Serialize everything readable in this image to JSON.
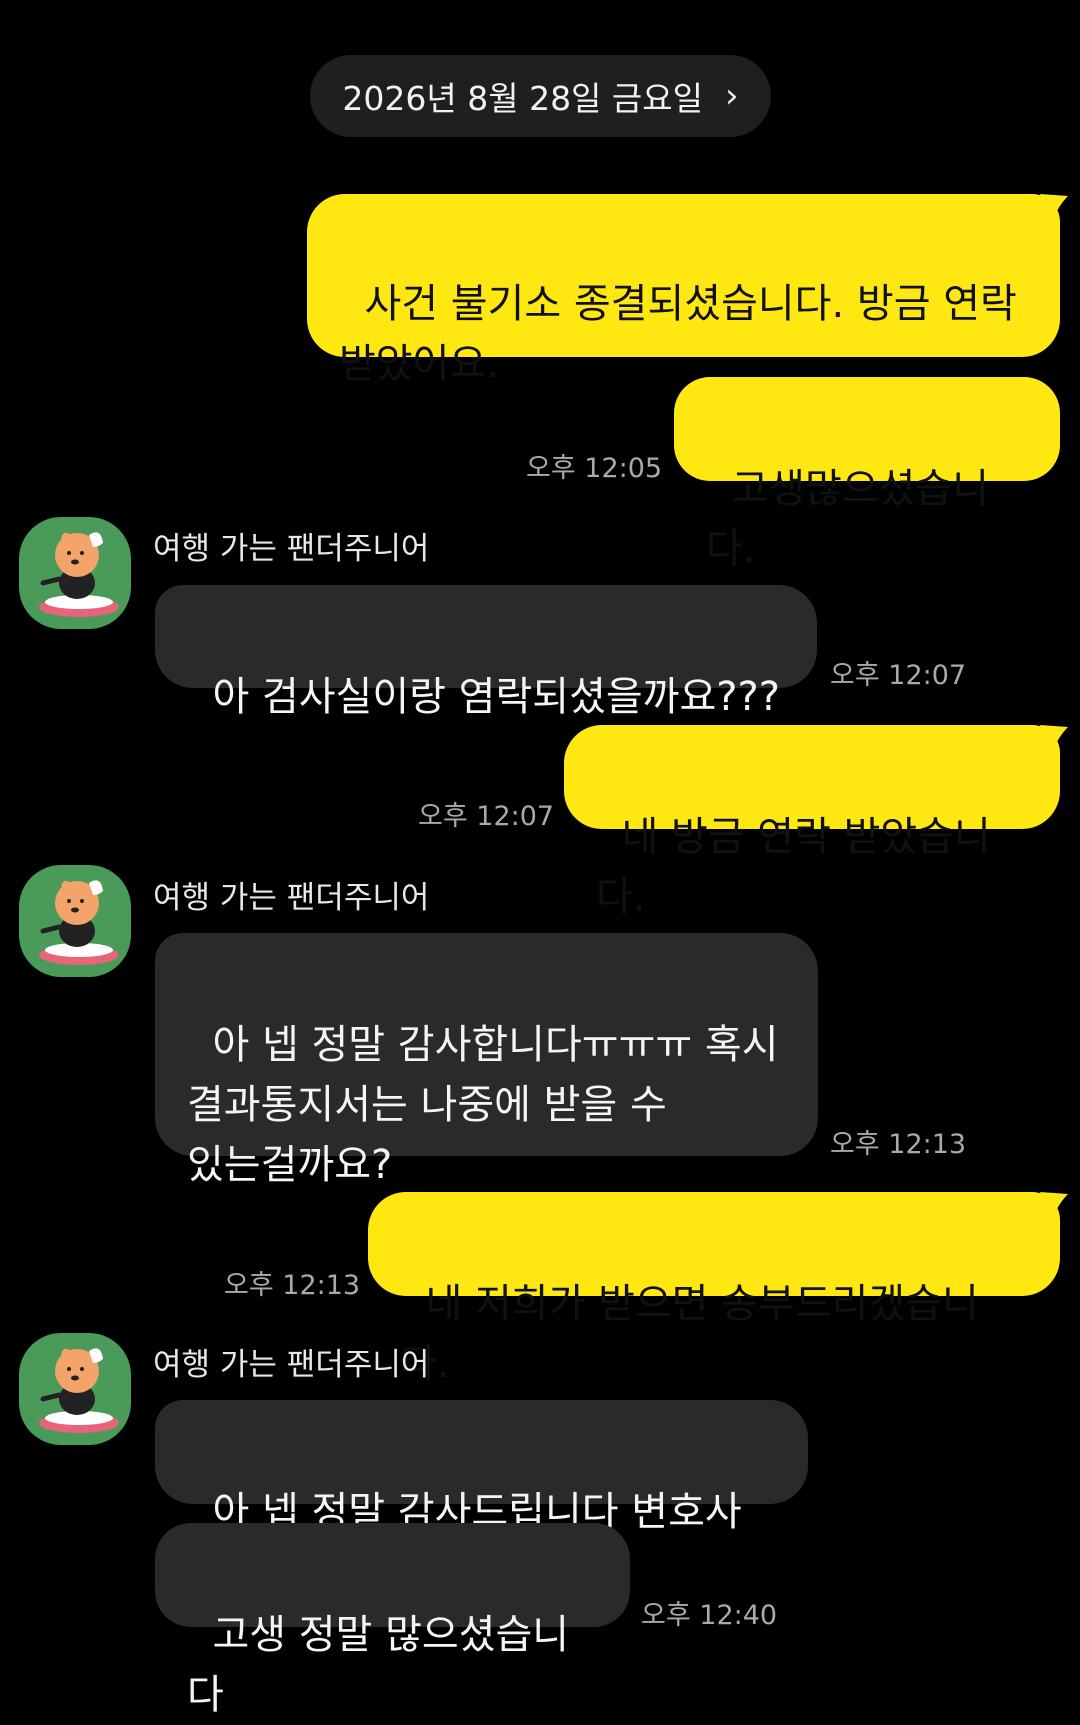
{
  "date_divider": {
    "label": "2026년 8월 28일 금요일",
    "chevron": "›"
  },
  "messages": [
    {
      "side": "sent",
      "text": "사건 불기소 종결되셨습니다. 방금 연락\n받았어요.",
      "time": ""
    },
    {
      "side": "sent",
      "text": "고생많으셨습니다.",
      "time": "오후 12:05"
    },
    {
      "side": "recv",
      "sender": "여행 가는 팬더주니어",
      "text": "아 검사실이랑 염락되셨을까요???",
      "time": "오후 12:07"
    },
    {
      "side": "sent",
      "text": "네 방금 연락 받았습니다.",
      "time": "오후 12:07"
    },
    {
      "side": "recv",
      "sender": "여행 가는 팬더주니어",
      "text": "아 넵 정말 감사합니다ㅠㅠㅠ 혹시\n결과통지서는 나중에 받을 수\n있는걸까요?",
      "time": "오후 12:13"
    },
    {
      "side": "sent",
      "text": "네 저희가 받으면 송부드리겠습니다.",
      "time": "오후 12:13"
    },
    {
      "side": "recv",
      "sender": "여행 가는 팬더주니어",
      "text": "아 넵 정말 감사드립니다 변호사님",
      "time": ""
    },
    {
      "side": "recv",
      "text": "고생 정말 많으셨습니다",
      "time": "오후 12:40"
    }
  ],
  "colors": {
    "background": "#000000",
    "sent_bubble": "#ffe812",
    "recv_bubble": "#2a2a2a",
    "avatar_bg": "#4a9a5a",
    "timestamp": "#a9a9a9"
  },
  "icons": {
    "chevron": "chevron-right-icon",
    "avatar": "panda-character-avatar"
  }
}
